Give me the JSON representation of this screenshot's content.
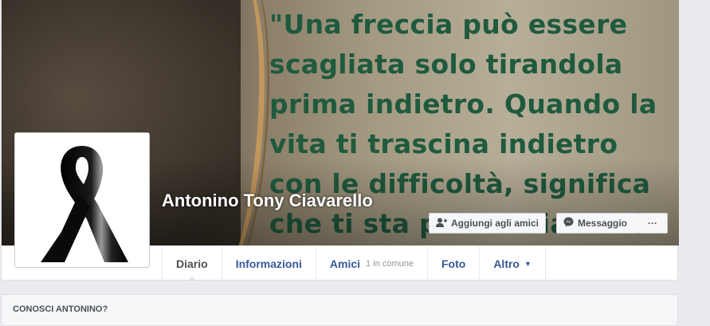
{
  "cover": {
    "quote": "\"Una freccia può essere\nscagliata solo tirandola\nprima indietro. Quando la\nvita ti trascina indietro\ncon le difficoltà, significa\nche ti sta per lanciare in\nqualcosa di grande"
  },
  "profile": {
    "name": "Antonino Tony Ciavarello",
    "avatar_icon": "black-ribbon-icon"
  },
  "actions": {
    "add_friend_label": "Aggiungi agli amici",
    "add_friend_icon": "add-friend-icon",
    "message_label": "Messaggio",
    "message_icon": "messenger-icon",
    "more_label": "···"
  },
  "nav": {
    "tabs": [
      {
        "label": "Diario",
        "active": true
      },
      {
        "label": "Informazioni"
      },
      {
        "label": "Amici",
        "sub": "1 in comune"
      },
      {
        "label": "Foto"
      },
      {
        "label": "Altro",
        "caret": "▼"
      }
    ]
  },
  "know": {
    "title": "CONOSCI ANTONINO?"
  },
  "colors": {
    "link": "#365899",
    "quote_text": "#1f5a3e",
    "page_bg": "#e9ebee"
  }
}
